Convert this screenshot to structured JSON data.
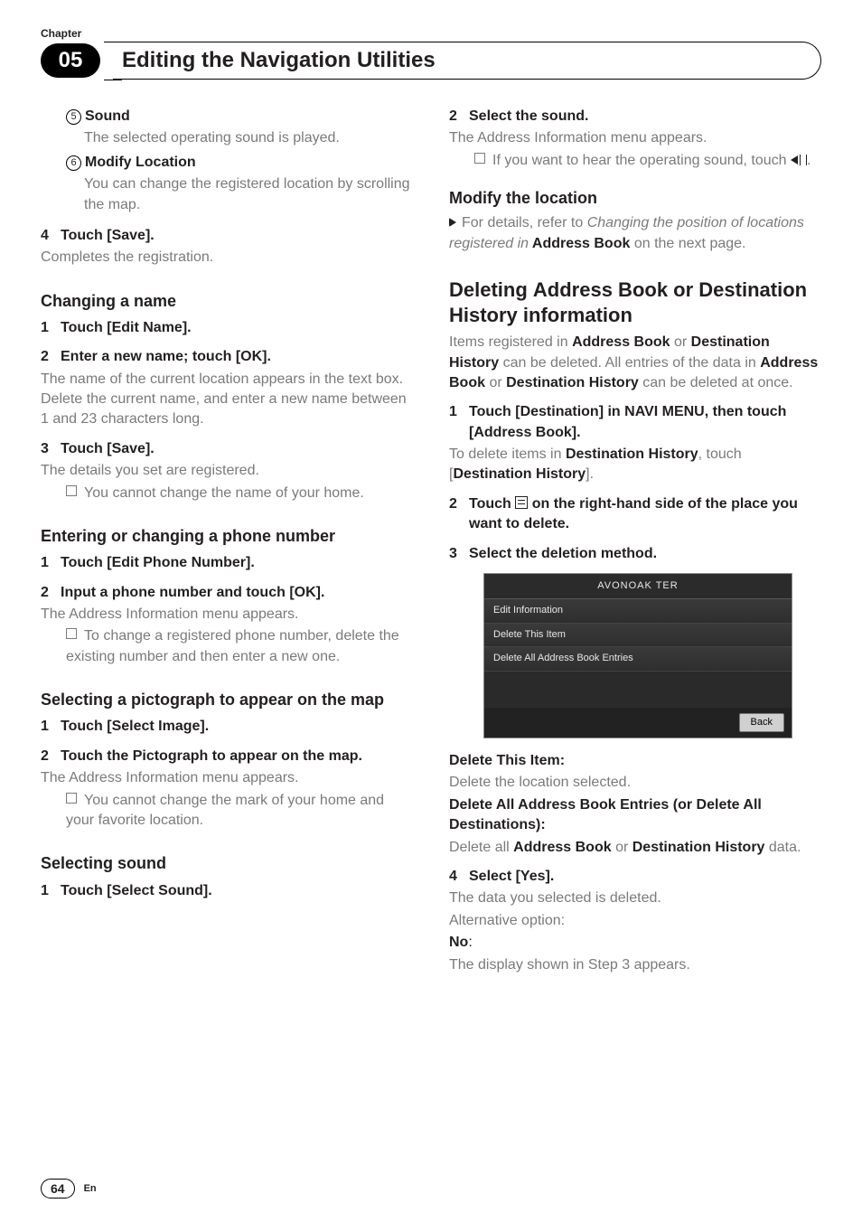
{
  "header": {
    "kicker": "Chapter",
    "number": "05",
    "title": "Editing the Navigation Utilities"
  },
  "left": {
    "i5_label": "Sound",
    "i5_body": "The selected operating sound is played.",
    "i6_label": "Modify Location",
    "i6_body": "You can change the registered location by scrolling the map.",
    "s4_title": "Touch [Save].",
    "s4_body": "Completes the registration.",
    "h_change_name": "Changing a name",
    "cn1": "Touch [Edit Name].",
    "cn2": "Enter a new name; touch [OK].",
    "cn2_body": "The name of the current location appears in the text box. Delete the current name, and enter a new name between 1 and 23 characters long.",
    "cn3": "Touch [Save].",
    "cn3_body": "The details you set are registered.",
    "cn3_note": "You cannot change the name of your home.",
    "h_phone": "Entering or changing a phone number",
    "ph1": "Touch [Edit Phone Number].",
    "ph2": "Input a phone number and touch [OK].",
    "ph2_body": "The Address Information menu appears.",
    "ph2_note": "To change a registered phone number, delete the existing number and then enter a new one.",
    "h_picto": "Selecting a pictograph to appear on the map",
    "pi1": "Touch [Select Image].",
    "pi2": "Touch the Pictograph to appear on the map.",
    "pi2_body": "The Address Information menu appears.",
    "pi2_note": "You cannot change the mark of your home and your favorite location.",
    "h_sound": "Selecting sound",
    "so1": "Touch [Select Sound]."
  },
  "right": {
    "r2": "Select the sound.",
    "r2_body": "The Address Information menu appears.",
    "r2_note_a": "If you want to hear the operating sound, touch ",
    "r2_note_b": ".",
    "h_modloc": "Modify the location",
    "modloc_a": "For details, refer to ",
    "modloc_i": "Changing the position of locations registered in",
    "modloc_b": " Address Book",
    "modloc_c": " on the next page.",
    "h_delete_a": "Deleting ",
    "h_delete_b": "Address Book",
    "h_delete_c": " or ",
    "h_delete_d": "Destination History",
    "h_delete_e": " information",
    "del_p1_a": "Items registered in ",
    "del_p1_b": "Address Book",
    "del_p1_c": " or ",
    "del_p1_d": "Destination History",
    "del_p1_e": " can be deleted. All entries of the data in ",
    "del_p1_f": "Address Book",
    "del_p1_g": " or ",
    "del_p1_h": "Destination History",
    "del_p1_i": " can be deleted at once.",
    "d1_a": "Touch [Destination] in NAVI MENU, then touch [Address Book].",
    "d1_body_a": "To delete items in ",
    "d1_body_b": "Destination History",
    "d1_body_c": ", touch [",
    "d1_body_d": "Destination History",
    "d1_body_e": "].",
    "d2_a": "Touch ",
    "d2_b": " on the right-hand side of the place you want to delete.",
    "d3": "Select the deletion method.",
    "screenshot": {
      "title": "AVONOAK TER",
      "row1": "Edit Information",
      "row2": "Delete This Item",
      "row3": "Delete All Address Book Entries",
      "back": "Back"
    },
    "dt_h": "Delete This Item:",
    "dt_b": "Delete the location selected.",
    "da_h": "Delete All Address Book Entries (or Delete All Destinations):",
    "da_b_a": "Delete all ",
    "da_b_b": "Address Book",
    "da_b_c": " or ",
    "da_b_d": "Destination History",
    "da_b_e": " data.",
    "d4": "Select [Yes].",
    "d4_b1": "The data you selected is deleted.",
    "d4_b2": "Alternative option:",
    "no_h": "No",
    "no_b": "The display shown in Step 3 appears."
  },
  "footer": {
    "page": "64",
    "lang": "En"
  }
}
